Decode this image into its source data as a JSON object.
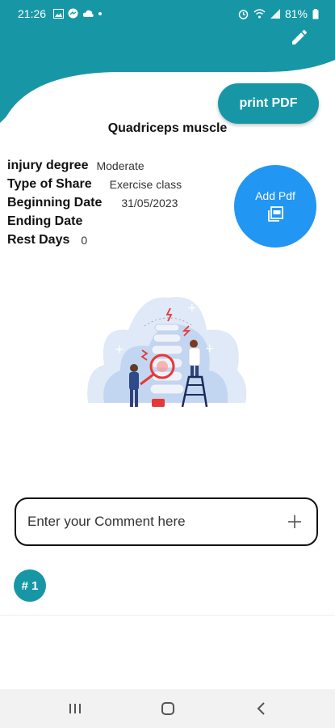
{
  "status": {
    "time": "21:26",
    "battery": "81%"
  },
  "actions": {
    "print_label": "print PDF",
    "add_pdf_label": "Add Pdf"
  },
  "page": {
    "title": "Quadriceps muscle"
  },
  "details": {
    "injury_degree_label": "injury degree",
    "injury_degree_value": "Moderate",
    "type_label": "Type of Share",
    "type_value": "Exercise class",
    "begin_label": "Beginning Date",
    "begin_value": "31/05/2023",
    "end_label": "Ending Date",
    "end_value": "",
    "rest_label": "Rest Days",
    "rest_value": "0"
  },
  "comment": {
    "placeholder": "Enter your Comment here"
  },
  "comments_list": {
    "count_label": "# 1"
  },
  "colors": {
    "primary": "#1797a6",
    "accent": "#2196f3"
  },
  "icons": [
    "gallery-icon",
    "messenger-icon",
    "cloud-icon",
    "alarm-icon",
    "wifi-icon",
    "signal-icon",
    "battery-icon",
    "edit-icon",
    "pdf-icon",
    "plus-icon",
    "recents-icon",
    "home-icon",
    "back-icon"
  ]
}
